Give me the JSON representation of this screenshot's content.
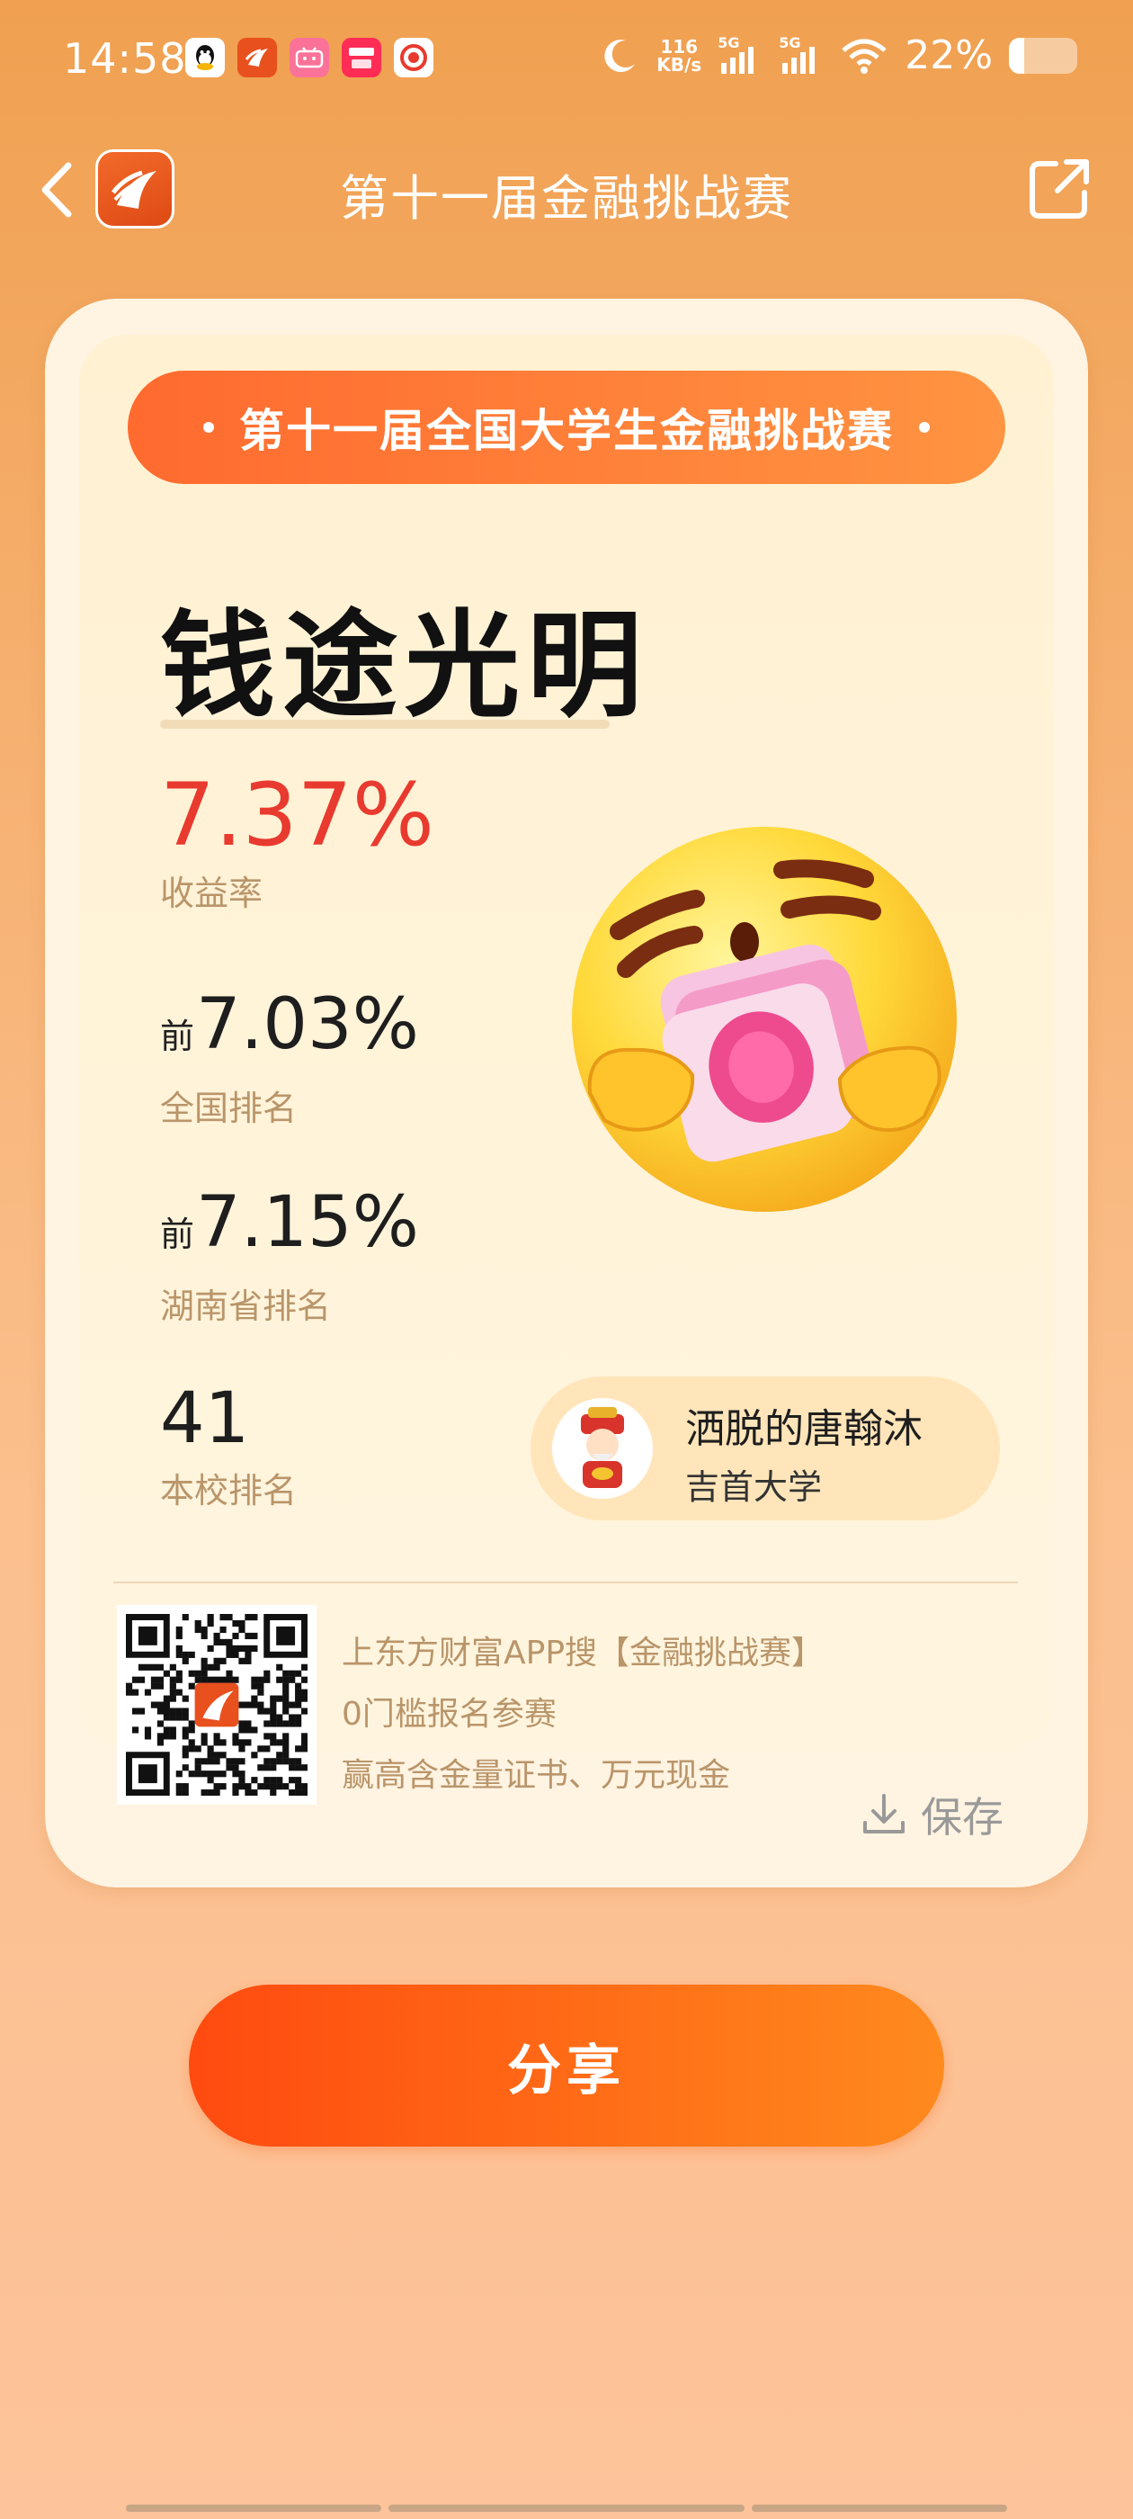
{
  "status_bar": {
    "time": "14:58",
    "net_speed_value": "116",
    "net_speed_unit": "KB/s",
    "signal1": "5G",
    "signal2": "5G",
    "battery_text": "22%",
    "battery_level": 0.22,
    "app_icons": [
      "qq-icon",
      "eastmoney-icon",
      "bilibili-icon",
      "red-app-icon",
      "recorder-icon"
    ]
  },
  "nav": {
    "title": "第十一届金融挑战赛"
  },
  "card": {
    "banner_text": "第十一届全国大学生金融挑战赛",
    "headline": "钱途光明",
    "return_value": "7.37%",
    "return_label": "收益率",
    "national_prefix": "前",
    "national_value": "7.03%",
    "national_label": "全国排名",
    "province_prefix": "前",
    "province_value": "7.15%",
    "province_label": "湖南省排名",
    "school_rank_value": "41",
    "school_rank_label": "本校排名",
    "user_name": "洒脱的唐翰沐",
    "user_school": "吉首大学",
    "promo_lines": [
      "上东方财富APP搜【金融挑战赛】",
      "0门槛报名参赛",
      "赢高含金量证书、万元现金"
    ],
    "save_label": "保存"
  },
  "share_label": "分享",
  "colors": {
    "accent": "#ff6a2f",
    "return_red": "#e83a2f",
    "label_tan": "#b9956a"
  }
}
